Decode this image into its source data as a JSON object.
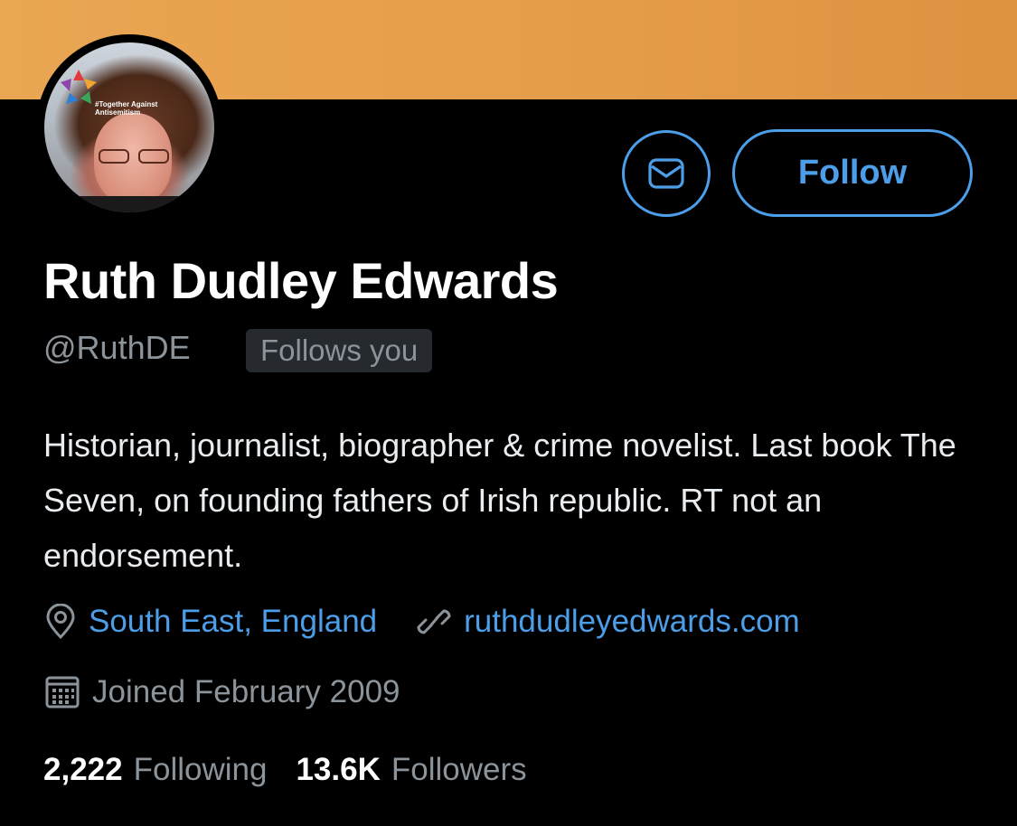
{
  "colors": {
    "banner": "#e59c4a",
    "accent": "#4c9ee8",
    "background": "#000000",
    "text_primary": "#ffffff",
    "text_secondary": "#8b939b",
    "badge_bg": "#26292d"
  },
  "avatar": {
    "caption": "#Together Against Antisemitism"
  },
  "actions": {
    "message_icon": "envelope-icon",
    "follow_label": "Follow"
  },
  "profile": {
    "name": "Ruth Dudley Edwards",
    "handle": "@RuthDE",
    "follows_you": "Follows you",
    "bio": "Historian, journalist, biographer & crime novelist. Last book The Seven, on founding fathers of Irish republic. RT not an endorsement.",
    "location": "South East, England",
    "location_icon": "location-pin-icon",
    "website": "ruthdudleyedwards.com",
    "website_icon": "link-icon",
    "joined": "Joined February 2009",
    "joined_icon": "calendar-icon"
  },
  "stats": {
    "following_count": "2,222",
    "following_label": "Following",
    "followers_count": "13.6K",
    "followers_label": "Followers"
  }
}
